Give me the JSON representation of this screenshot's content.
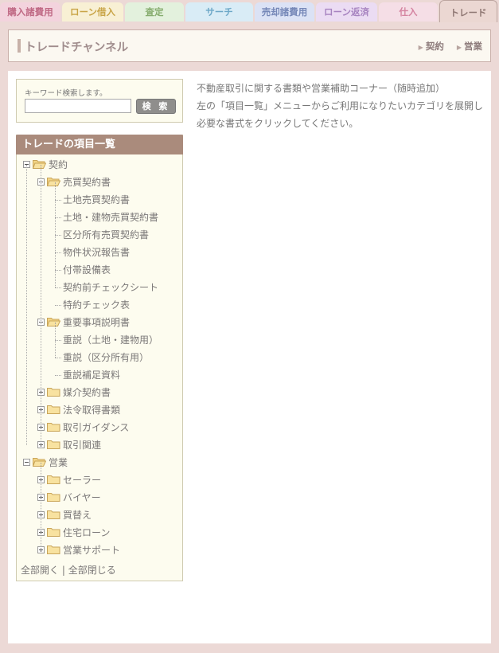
{
  "tabs": [
    {
      "label": "購入諸費用",
      "bg": "#f3d3dd",
      "fg": "#c06a85"
    },
    {
      "label": "ローン借入",
      "bg": "#f8f0d4",
      "fg": "#c9a548"
    },
    {
      "label": "査定",
      "bg": "#e3f1dd",
      "fg": "#87ad6f"
    },
    {
      "label": "サーチ",
      "bg": "#d9ecf6",
      "fg": "#6da8c8"
    },
    {
      "label": "売却諸費用",
      "bg": "#dbe2f5",
      "fg": "#7688b8"
    },
    {
      "label": "ローン返済",
      "bg": "#ebdcf3",
      "fg": "#a784c0"
    },
    {
      "label": "仕入",
      "bg": "#f5dee6",
      "fg": "#d483a0"
    },
    {
      "label": "トレード",
      "bg": "#ebd7d2",
      "fg": "#8f7773"
    }
  ],
  "header": {
    "title": "トレードチャンネル",
    "links": [
      "契約",
      "営業"
    ]
  },
  "search": {
    "hint": "キーワード検索します。",
    "placeholder": "",
    "value": "",
    "button": "検 索"
  },
  "tree": {
    "title": "トレードの項目一覧",
    "nodes": [
      {
        "label": "契約",
        "depth": 0,
        "type": "folder",
        "open": true
      },
      {
        "label": "売買契約書",
        "depth": 1,
        "type": "folder",
        "open": true
      },
      {
        "label": "土地売買契約書",
        "depth": 2,
        "type": "leaf"
      },
      {
        "label": "土地・建物売買契約書",
        "depth": 2,
        "type": "leaf"
      },
      {
        "label": "区分所有売買契約書",
        "depth": 2,
        "type": "leaf"
      },
      {
        "label": "物件状況報告書",
        "depth": 2,
        "type": "leaf"
      },
      {
        "label": "付帯設備表",
        "depth": 2,
        "type": "leaf"
      },
      {
        "label": "契約前チェックシート",
        "depth": 2,
        "type": "leaf"
      },
      {
        "label": "特約チェック表",
        "depth": 2,
        "type": "leaf"
      },
      {
        "label": "重要事項説明書",
        "depth": 1,
        "type": "folder",
        "open": true
      },
      {
        "label": "重説（土地・建物用）",
        "depth": 2,
        "type": "leaf"
      },
      {
        "label": "重説（区分所有用）",
        "depth": 2,
        "type": "leaf"
      },
      {
        "label": "重説補足資料",
        "depth": 2,
        "type": "leaf"
      },
      {
        "label": "媒介契約書",
        "depth": 1,
        "type": "folder",
        "open": false
      },
      {
        "label": "法令取得書類",
        "depth": 1,
        "type": "folder",
        "open": false
      },
      {
        "label": "取引ガイダンス",
        "depth": 1,
        "type": "folder",
        "open": false
      },
      {
        "label": "取引関連",
        "depth": 1,
        "type": "folder",
        "open": false
      },
      {
        "label": "営業",
        "depth": 0,
        "type": "folder",
        "open": true
      },
      {
        "label": "セーラー",
        "depth": 1,
        "type": "folder",
        "open": false
      },
      {
        "label": "バイヤー",
        "depth": 1,
        "type": "folder",
        "open": false
      },
      {
        "label": "買替え",
        "depth": 1,
        "type": "folder",
        "open": false
      },
      {
        "label": "住宅ローン",
        "depth": 1,
        "type": "folder",
        "open": false
      },
      {
        "label": "営業サポート",
        "depth": 1,
        "type": "folder",
        "open": false
      }
    ],
    "expand_all": "全部開く",
    "separator": "|",
    "collapse_all": "全部閉じる"
  },
  "description": [
    "不動産取引に関する書類や営業補助コーナー（随時追加）",
    "左の「項目一覧」メニューからご利用になりたいカテゴリを展開し",
    "必要な書式をクリックしてください。"
  ]
}
